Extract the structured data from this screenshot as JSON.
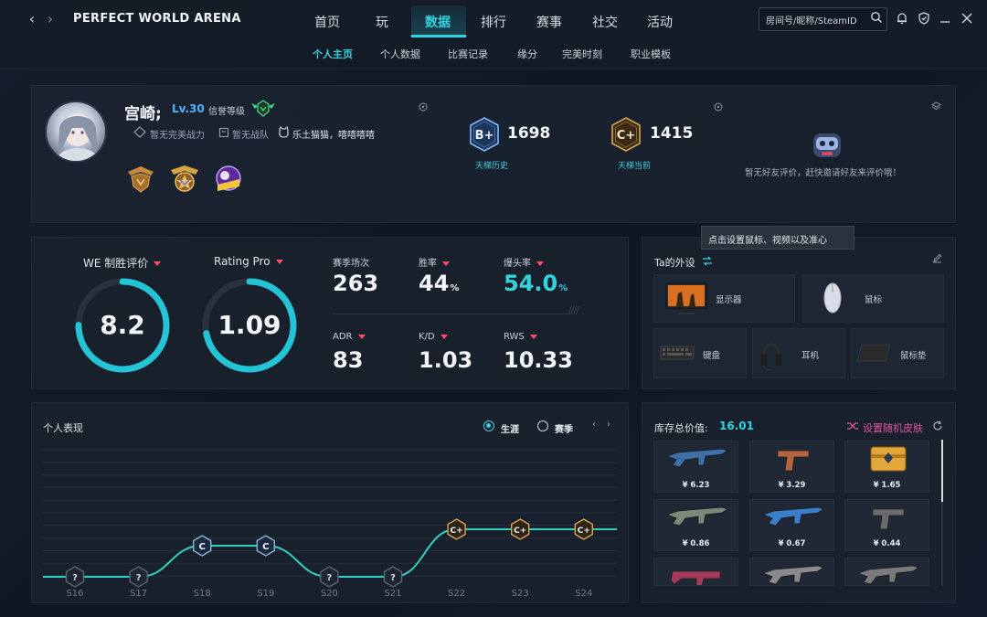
{
  "app": {
    "brand": "PERFECT WORLD ARENA",
    "back_glyph": "‹",
    "forward_glyph": "›",
    "main_tabs": [
      "首页",
      "玩",
      "数据",
      "排行",
      "赛事",
      "社交",
      "活动"
    ],
    "active_main_tab": "数据",
    "search_placeholder": "房间号/昵称/SteamID",
    "sub_tabs": [
      "个人主页",
      "个人数据",
      "比赛记录",
      "缘分",
      "完美时刻",
      "职业模板"
    ],
    "active_sub_tab": "个人主页",
    "accent": "#31d3e0"
  },
  "profile": {
    "name": "宫崎;",
    "level": "Lv.30",
    "credit_label": "信誉等级",
    "power": "暂无完美战力",
    "team": "暂无战队",
    "clan": "乐土猫猫，嘻嘻嘻嘻",
    "ladder_history": {
      "rank": "B+",
      "value": "1698",
      "label": "天梯历史"
    },
    "ladder_current": {
      "rank": "C+",
      "value": "1415",
      "label": "天梯当前"
    },
    "friend_review": "暂无好友评价，赶快邀请好友来评价哦！"
  },
  "ratings": {
    "we_label": "WE 制胜评价",
    "we_value": "8.2",
    "we_fraction": 0.75,
    "pro_label": "Rating Pro",
    "pro_value": "1.09",
    "pro_fraction": 0.72,
    "stats": [
      {
        "label": "赛季场次",
        "value": "263",
        "suffix": "",
        "caret": false,
        "cyan": false
      },
      {
        "label": "胜率",
        "value": "44",
        "suffix": "%",
        "caret": true,
        "cyan": false
      },
      {
        "label": "爆头率",
        "value": "54.0",
        "suffix": "%",
        "caret": true,
        "cyan": true
      },
      {
        "label": "ADR",
        "value": "83",
        "suffix": "",
        "caret": true,
        "cyan": false
      },
      {
        "label": "K/D",
        "value": "1.03",
        "suffix": "",
        "caret": true,
        "cyan": false
      },
      {
        "label": "RWS",
        "value": "10.33",
        "suffix": "",
        "caret": true,
        "cyan": false
      }
    ]
  },
  "setup": {
    "title": "Ta的外设",
    "tooltip": "点击设置鼠标、视频以及准心",
    "items": [
      "显示器",
      "鼠标",
      "键盘",
      "耳机",
      "鼠标垫"
    ]
  },
  "performance": {
    "title": "个人表现",
    "option_career": "生涯",
    "option_event": "赛季",
    "selected": "生涯",
    "chart_data": {
      "type": "line",
      "x": [
        "S16",
        "S17",
        "S18",
        "S19",
        "S20",
        "S21",
        "S22",
        "S23",
        "S24"
      ],
      "ranks": [
        "?",
        "?",
        "C",
        "C",
        "?",
        "?",
        "C+",
        "C+",
        "C+"
      ],
      "levels": [
        0,
        0,
        1,
        1,
        0,
        0,
        2,
        2,
        2
      ]
    }
  },
  "inventory": {
    "title": "库存总价值:",
    "total": "16.01",
    "random_skin": "设置随机皮肤",
    "items": [
      {
        "price": "¥ 6.23",
        "kind": "rifle",
        "color": "#3d6fa8"
      },
      {
        "price": "¥ 3.29",
        "kind": "pistol",
        "color": "#b5653e"
      },
      {
        "price": "¥ 1.65",
        "kind": "case",
        "color": "#e2a63a"
      },
      {
        "price": "¥ 0.86",
        "kind": "rifle",
        "color": "#7d8a7a"
      },
      {
        "price": "¥ 0.67",
        "kind": "rifle",
        "color": "#3b7ec9"
      },
      {
        "price": "¥ 0.44",
        "kind": "pistol",
        "color": "#6a6a6a"
      },
      {
        "price": "",
        "kind": "smg",
        "color": "#a33a5c"
      },
      {
        "price": "",
        "kind": "rifle",
        "color": "#8a8a8a"
      },
      {
        "price": "",
        "kind": "rifle",
        "color": "#7a7a7a"
      }
    ]
  }
}
